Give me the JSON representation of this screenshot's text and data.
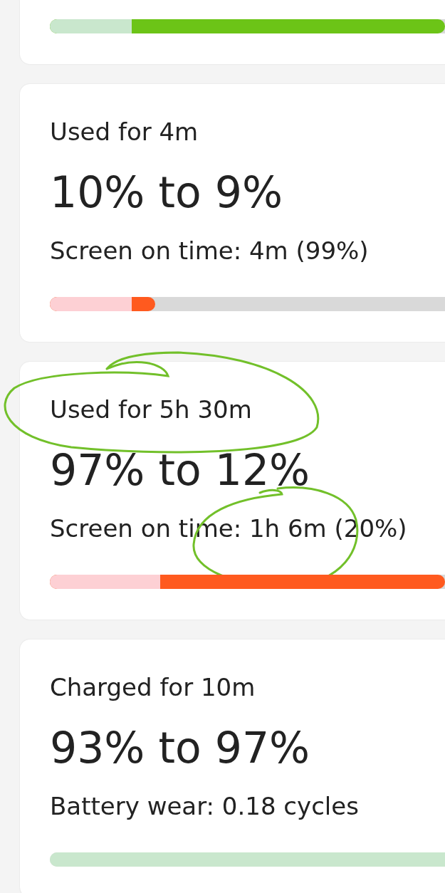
{
  "cards": [
    {
      "kind": "charge",
      "bar": [
        {
          "kind": "base",
          "level": 0.207
        },
        {
          "kind": "change",
          "level": 1.0
        }
      ]
    },
    {
      "kind": "usage",
      "title": "Used for 4m",
      "range": "10% to 9%",
      "detail": "Screen on time: 4m (99%)",
      "bar": [
        {
          "kind": "base",
          "level": 0.207
        },
        {
          "kind": "change",
          "level": 0.267
        }
      ]
    },
    {
      "kind": "usage",
      "title": "Used for 5h 30m",
      "range": "97% to 12%",
      "detail": "Screen on time: 1h 6m (20%)",
      "bar": [
        {
          "kind": "base",
          "level": 0.28
        },
        {
          "kind": "change",
          "level": 1.0
        }
      ]
    },
    {
      "kind": "charge",
      "title": "Charged for 10m",
      "range": "93% to 97%",
      "detail": "Battery wear: 0.18 cycles",
      "bar": [
        {
          "kind": "base",
          "level": 1.0
        }
      ]
    }
  ]
}
